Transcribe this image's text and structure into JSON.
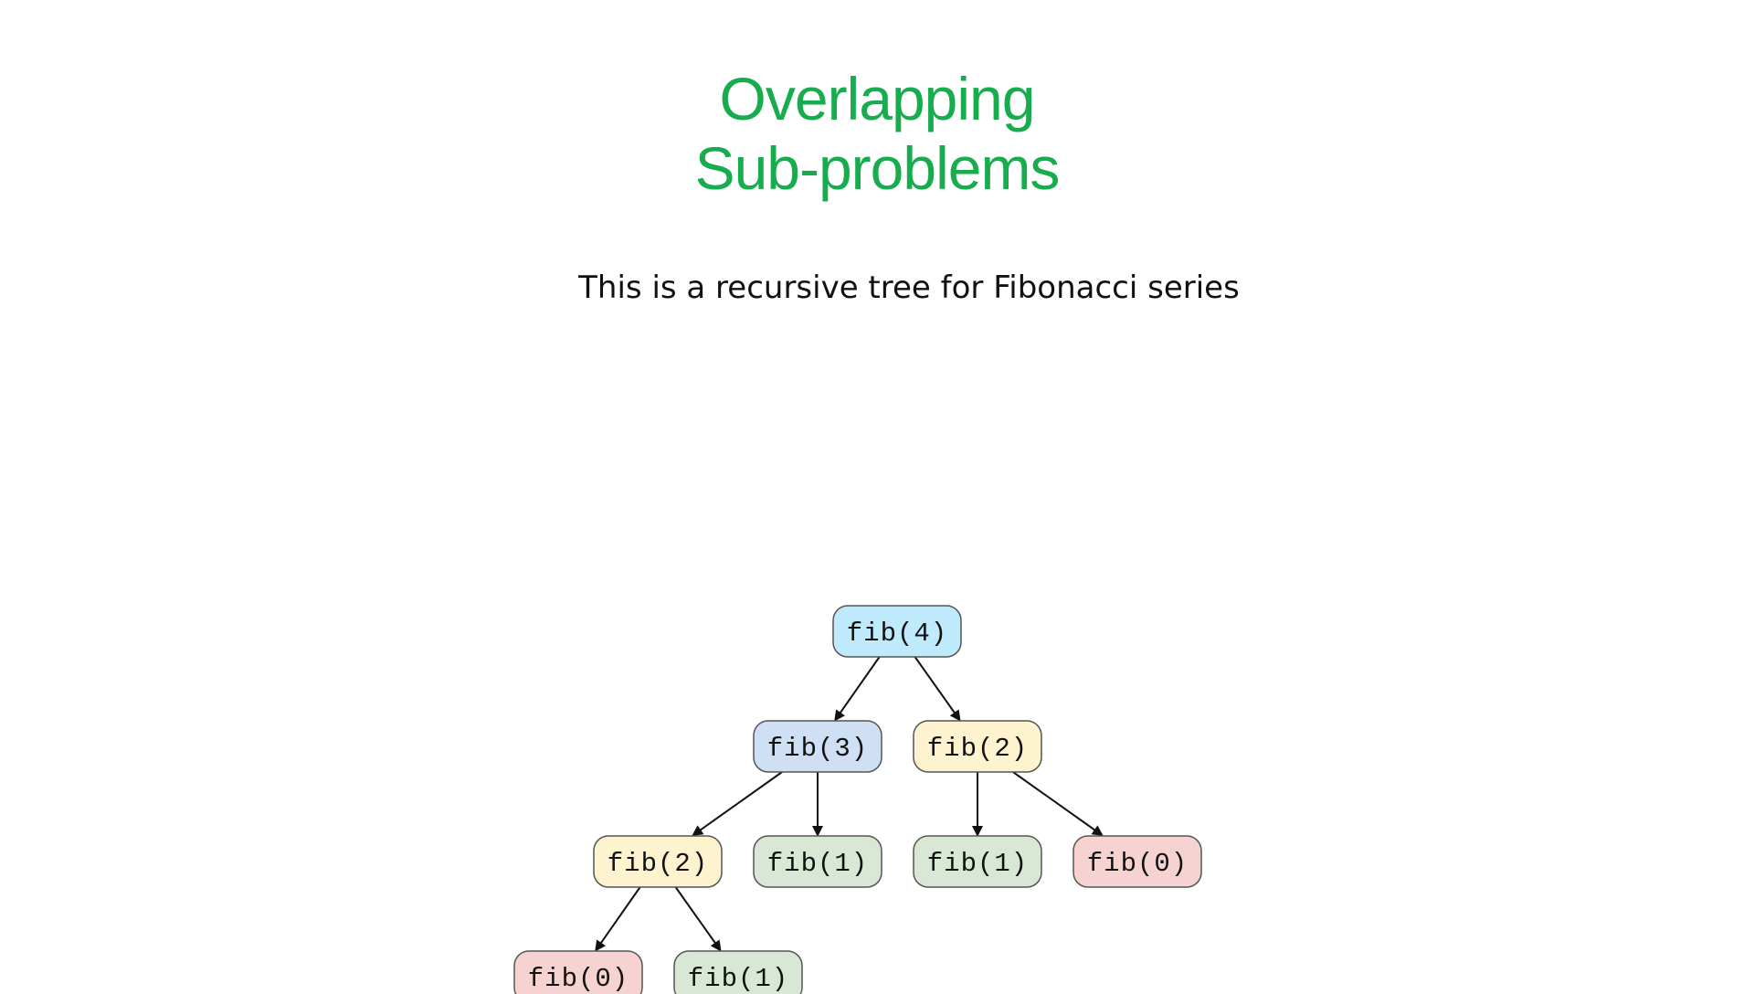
{
  "slide": {
    "title_line1": "Overlapping",
    "title_line2": "Sub-problems",
    "subtitle": "This is a recursive tree for Fibonacci series"
  },
  "colors": {
    "title": "#17ac4e",
    "fib4": "#bfeafc",
    "fib3": "#cfe0f5",
    "fib2": "#fdf3cf",
    "fib1": "#d8e8d4",
    "fib0": "#f6d3d1",
    "border": "#555555",
    "edge": "#111111"
  },
  "tree": {
    "nodes": [
      {
        "id": "n4",
        "label": "fib(4)",
        "color": "fib4"
      },
      {
        "id": "n3",
        "label": "fib(3)",
        "color": "fib3"
      },
      {
        "id": "n2a",
        "label": "fib(2)",
        "color": "fib2"
      },
      {
        "id": "n2b",
        "label": "fib(2)",
        "color": "fib2"
      },
      {
        "id": "n1a",
        "label": "fib(1)",
        "color": "fib1"
      },
      {
        "id": "n1b",
        "label": "fib(1)",
        "color": "fib1"
      },
      {
        "id": "n0a",
        "label": "fib(0)",
        "color": "fib0"
      },
      {
        "id": "n0b",
        "label": "fib(0)",
        "color": "fib0"
      },
      {
        "id": "n1c",
        "label": "fib(1)",
        "color": "fib1"
      }
    ],
    "edges": [
      {
        "from": "n4",
        "to": "n3"
      },
      {
        "from": "n4",
        "to": "n2b"
      },
      {
        "from": "n3",
        "to": "n2a"
      },
      {
        "from": "n3",
        "to": "n1a"
      },
      {
        "from": "n2b",
        "to": "n1b"
      },
      {
        "from": "n2b",
        "to": "n0a"
      },
      {
        "from": "n2a",
        "to": "n0b"
      },
      {
        "from": "n2a",
        "to": "n1c"
      }
    ]
  }
}
